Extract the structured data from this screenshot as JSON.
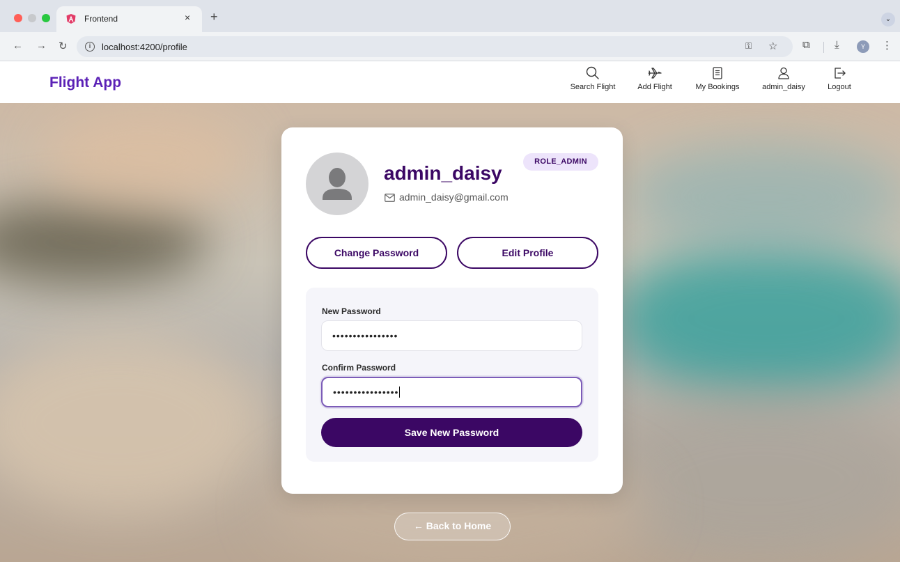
{
  "browser": {
    "tab_title": "Frontend",
    "tab_close": "×",
    "new_tab": "+",
    "tab_menu": "⌄",
    "url": "localhost:4200/profile",
    "profile_initial": "Y"
  },
  "app": {
    "brand": "Flight App",
    "nav": [
      {
        "label": "Search Flight",
        "icon": "search-icon"
      },
      {
        "label": "Add Flight",
        "icon": "airplane-icon"
      },
      {
        "label": "My Bookings",
        "icon": "bookings-icon"
      },
      {
        "label": "admin_daisy",
        "icon": "user-icon"
      },
      {
        "label": "Logout",
        "icon": "logout-icon"
      }
    ]
  },
  "profile": {
    "username": "admin_daisy",
    "email": "admin_daisy@gmail.com",
    "role": "ROLE_ADMIN",
    "change_password_label": "Change Password",
    "edit_profile_label": "Edit Profile"
  },
  "password_form": {
    "new_password_label": "New Password",
    "new_password_value": "••••••••••••••••",
    "confirm_password_label": "Confirm Password",
    "confirm_password_value": "••••••••••••••••",
    "save_label": "Save New Password"
  },
  "back_label": "← Back to Home",
  "colors": {
    "brand": "#5b21b6",
    "primary": "#3b0764",
    "badge_bg": "#ede4fb"
  }
}
